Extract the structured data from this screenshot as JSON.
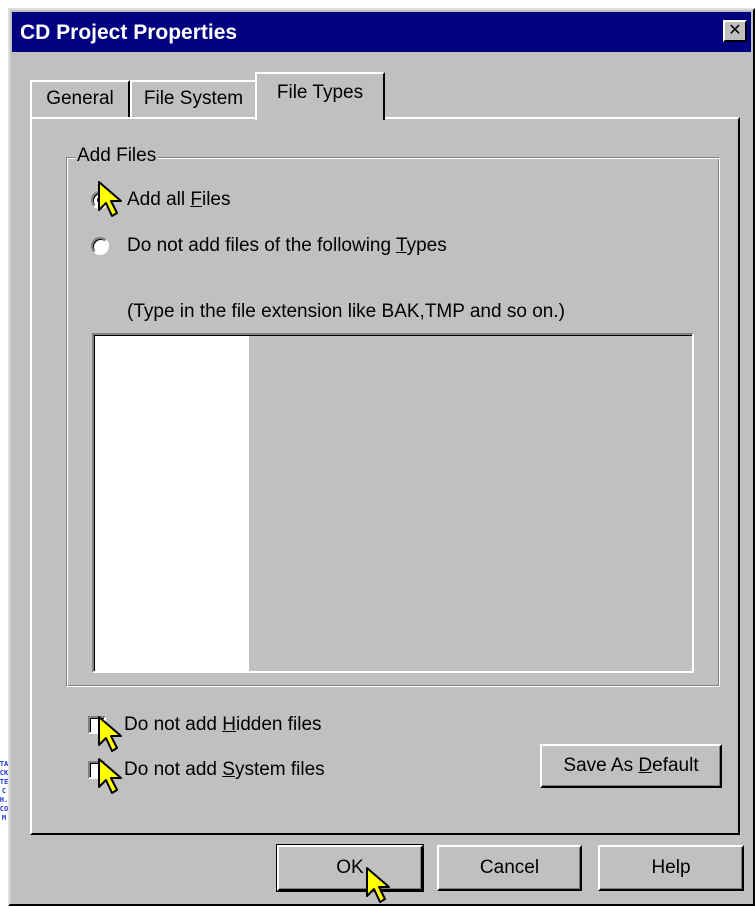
{
  "window": {
    "title": "CD Project Properties",
    "close_glyph": "✕"
  },
  "tabs": [
    {
      "label": "General",
      "active": false
    },
    {
      "label": "File System",
      "active": false
    },
    {
      "label": "File Types",
      "active": true
    }
  ],
  "add_files_group": {
    "label": "Add Files",
    "options": [
      {
        "before": "Add all ",
        "mnemonic": "F",
        "after": "iles",
        "selected": true
      },
      {
        "before": "Do not add files of the following ",
        "mnemonic": "T",
        "after": "ypes",
        "selected": false
      }
    ],
    "hint": "(Type in the file extension  like BAK,TMP and so on.)",
    "extension_list": []
  },
  "checkboxes": [
    {
      "before": "Do not add ",
      "mnemonic": "H",
      "after": "idden files",
      "checked": false
    },
    {
      "before": "Do not add ",
      "mnemonic": "S",
      "after": "ystem files",
      "checked": false
    }
  ],
  "buttons": {
    "save_default": {
      "before": "Save As ",
      "mnemonic": "D",
      "after": "efault"
    },
    "ok": "OK",
    "cancel": "Cancel",
    "help": "Help"
  },
  "watermark": "TACKTECH.COM",
  "colors": {
    "titlebar": "#000080",
    "face": "#c0c0c0",
    "cursor": "#ffff00",
    "watermark": "#1a3bd6"
  },
  "icons": [
    "close-icon",
    "pointer-cursor-icon"
  ]
}
